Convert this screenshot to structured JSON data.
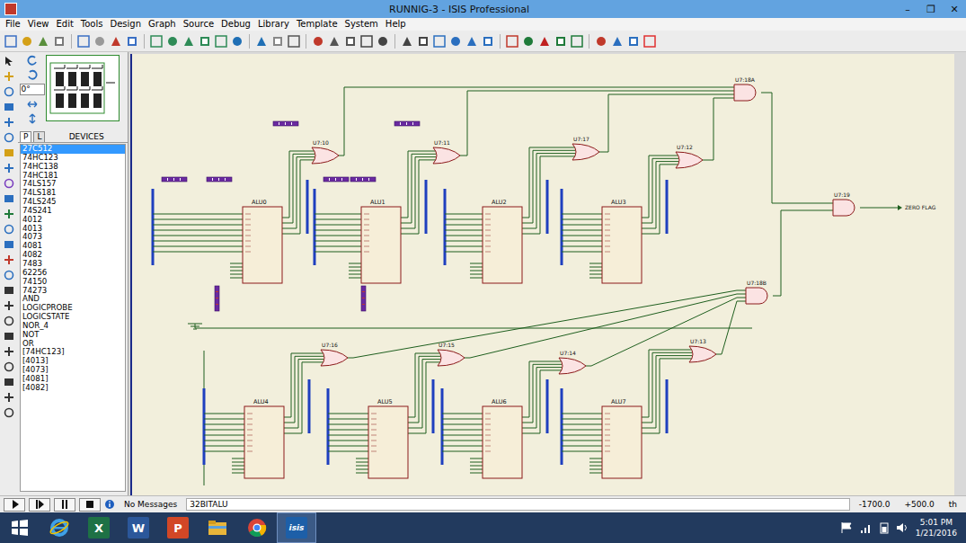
{
  "window": {
    "title": "RUNNIG-3 - ISIS Professional",
    "controls": [
      "–",
      "❐",
      "✕"
    ]
  },
  "menu": [
    "File",
    "View",
    "Edit",
    "Tools",
    "Design",
    "Graph",
    "Source",
    "Debug",
    "Library",
    "Template",
    "System",
    "Help"
  ],
  "panel": {
    "rotation": "0°",
    "tabs": [
      {
        "label": "P",
        "selected": true
      },
      {
        "label": "L",
        "selected": false
      }
    ],
    "header": "DEVICES",
    "devices": [
      {
        "label": "27C512",
        "selected": true
      },
      {
        "label": "74HC123",
        "selected": false
      },
      {
        "label": "74HC138",
        "selected": false
      },
      {
        "label": "74HC181",
        "selected": false
      },
      {
        "label": "74LS157",
        "selected": false
      },
      {
        "label": "74LS181",
        "selected": false
      },
      {
        "label": "74LS245",
        "selected": false
      },
      {
        "label": "74S241",
        "selected": false
      },
      {
        "label": "4012",
        "selected": false
      },
      {
        "label": "4013",
        "selected": false
      },
      {
        "label": "4073",
        "selected": false
      },
      {
        "label": "4081",
        "selected": false
      },
      {
        "label": "4082",
        "selected": false
      },
      {
        "label": "7483",
        "selected": false
      },
      {
        "label": "62256",
        "selected": false
      },
      {
        "label": "74150",
        "selected": false
      },
      {
        "label": "74273",
        "selected": false
      },
      {
        "label": "AND",
        "selected": false
      },
      {
        "label": "LOGICPROBE",
        "selected": false
      },
      {
        "label": "LOGICSTATE",
        "selected": false
      },
      {
        "label": "NOR_4",
        "selected": false
      },
      {
        "label": "NOT",
        "selected": false
      },
      {
        "label": "OR",
        "selected": false
      },
      {
        "label": "[74HC123]",
        "selected": false
      },
      {
        "label": "[4013]",
        "selected": false
      },
      {
        "label": "[4073]",
        "selected": false
      },
      {
        "label": "[4081]",
        "selected": false
      },
      {
        "label": "[4082]",
        "selected": false
      }
    ]
  },
  "schematic": {
    "chips": [
      "ALU0",
      "ALU1",
      "ALU2",
      "ALU3",
      "ALU4",
      "ALU5",
      "ALU6",
      "ALU7"
    ],
    "gates": [
      {
        "label": "U7:10",
        "kind": "or"
      },
      {
        "label": "U7:11",
        "kind": "or"
      },
      {
        "label": "U7:17",
        "kind": "or"
      },
      {
        "label": "U7:12",
        "kind": "or"
      },
      {
        "label": "U7:18A",
        "kind": "and"
      },
      {
        "label": "U7:19",
        "kind": "and"
      },
      {
        "label": "U7:18B",
        "kind": "and"
      },
      {
        "label": "U7:16",
        "kind": "or"
      },
      {
        "label": "U7:15",
        "kind": "or"
      },
      {
        "label": "U7:14",
        "kind": "or"
      },
      {
        "label": "U7:13",
        "kind": "or"
      }
    ],
    "output": "ZERO FLAG"
  },
  "status_bar": {
    "message": "No Messages",
    "sheet": "32BITALU",
    "x": "-1700.0",
    "y": "+500.0",
    "unit": "th"
  },
  "taskbar": {
    "apps": [
      {
        "kind": "start",
        "selected": false
      },
      {
        "kind": "ie",
        "selected": false
      },
      {
        "kind": "office",
        "glyph": "X",
        "color": "#1e7145",
        "selected": false
      },
      {
        "kind": "office",
        "glyph": "W",
        "color": "#2b579a",
        "selected": false
      },
      {
        "kind": "office",
        "glyph": "P",
        "color": "#d24726",
        "selected": false
      },
      {
        "kind": "explorer",
        "selected": false
      },
      {
        "kind": "chrome",
        "selected": false
      },
      {
        "kind": "isis",
        "glyph": "isis",
        "color": "#1d5fa8",
        "selected": true
      }
    ],
    "time": "5:01 PM",
    "date": "1/21/2016"
  }
}
